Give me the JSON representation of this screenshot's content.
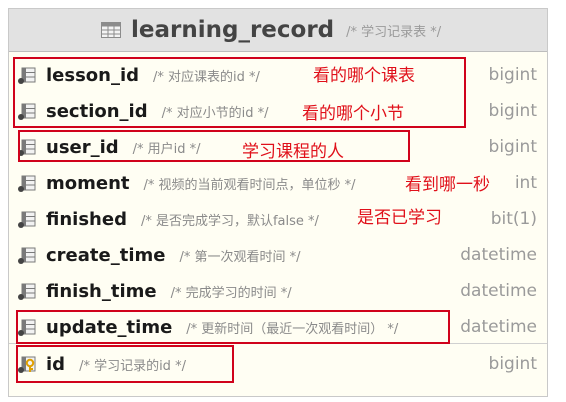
{
  "table": {
    "name": "learning_record",
    "comment": "/* 学习记录表 */",
    "columns": [
      {
        "name": "lesson_id",
        "comment": "/* 对应课表的id */",
        "type": "bigint",
        "icon": "column-icon"
      },
      {
        "name": "section_id",
        "comment": "/* 对应小节的id */",
        "type": "bigint",
        "icon": "column-icon"
      },
      {
        "name": "user_id",
        "comment": "/* 用户id */",
        "type": "bigint",
        "icon": "column-icon"
      },
      {
        "name": "moment",
        "comment": "/* 视频的当前观看时间点，单位秒 */",
        "type": "int",
        "icon": "column-icon"
      },
      {
        "name": "finished",
        "comment": "/* 是否完成学习，默认false */",
        "type": "bit(1)",
        "icon": "column-icon"
      },
      {
        "name": "create_time",
        "comment": "/* 第一次观看时间 */",
        "type": "datetime",
        "icon": "column-icon"
      },
      {
        "name": "finish_time",
        "comment": "/* 完成学习的时间 */",
        "type": "datetime",
        "icon": "column-icon"
      },
      {
        "name": "update_time",
        "comment": "/* 更新时间（最近一次观看时间） */",
        "type": "datetime",
        "icon": "column-icon"
      }
    ],
    "primary_key": {
      "name": "id",
      "comment": "/* 学习记录的id */",
      "type": "bigint",
      "icon": "key-icon"
    }
  },
  "annotations": {
    "lesson_note": "看的哪个课表",
    "section_note": "看的哪个小节",
    "user_note": "学习课程的人",
    "moment_note": "看到哪一秒",
    "finished_note": "是否已学习"
  },
  "colors": {
    "annotation": "#e0101a",
    "header_bg": "#e2e2e2",
    "card_bg": "#fffef3"
  }
}
